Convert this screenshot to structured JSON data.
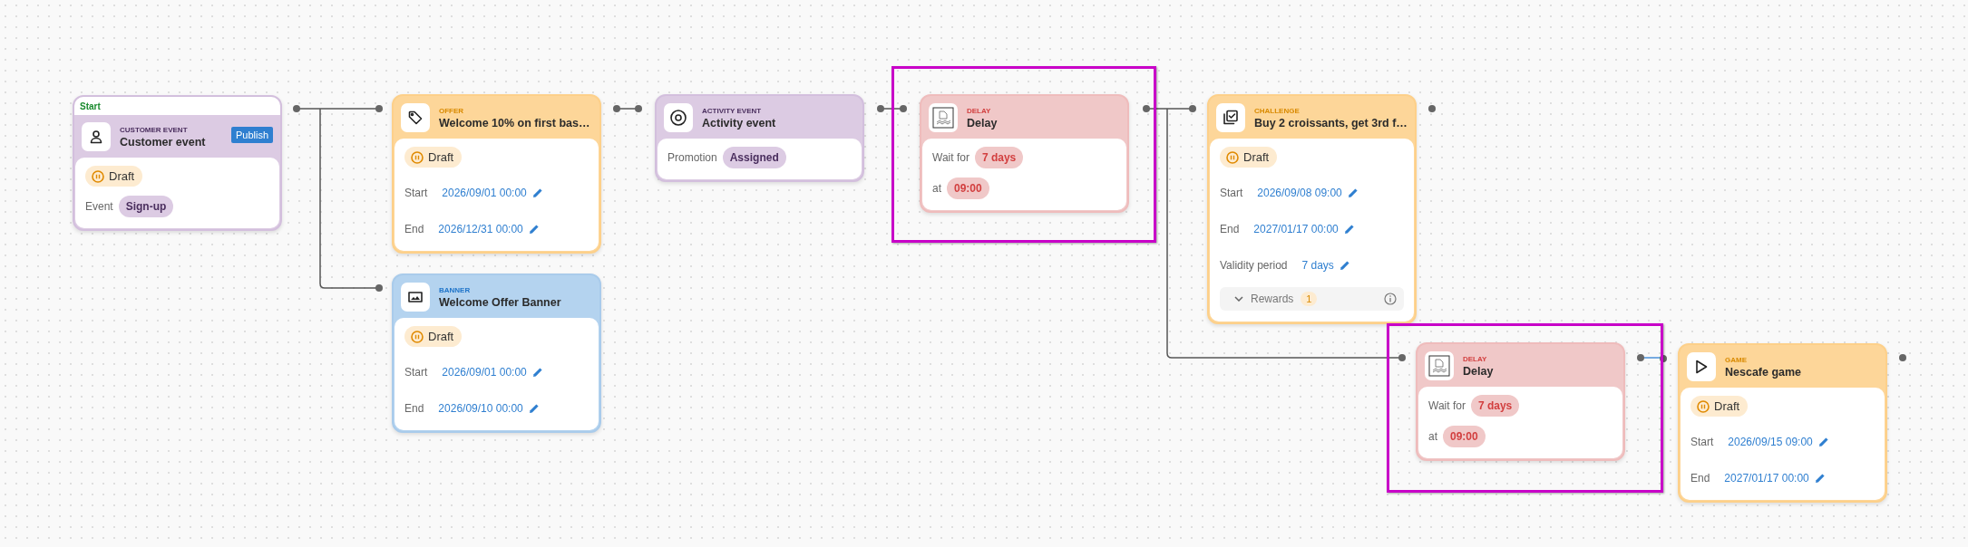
{
  "nodes": [
    {
      "kind": "customer_event",
      "start_label": "Start",
      "category": "CUSTOMER EVENT",
      "title": "Customer event",
      "action": "Publish",
      "status": "Draft",
      "highlighted": false,
      "fields": [
        {
          "kind": "chip",
          "label": "Event",
          "value": "Sign-up"
        }
      ]
    },
    {
      "kind": "offer",
      "category": "OFFER",
      "title": "Welcome 10% on first bas…",
      "status": "Draft",
      "highlighted": false,
      "fields": [
        {
          "kind": "editable",
          "label": "Start",
          "value": "2026/09/01 00:00"
        },
        {
          "kind": "editable",
          "label": "End",
          "value": "2026/12/31 00:00"
        }
      ]
    },
    {
      "kind": "banner",
      "category": "BANNER",
      "title": "Welcome Offer Banner",
      "status": "Draft",
      "highlighted": false,
      "fields": [
        {
          "kind": "editable",
          "label": "Start",
          "value": "2026/09/01 00:00"
        },
        {
          "kind": "editable",
          "label": "End",
          "value": "2026/09/10 00:00"
        }
      ]
    },
    {
      "kind": "activity_event",
      "category": "ACTIVITY EVENT",
      "title": "Activity event",
      "highlighted": false,
      "fields": [
        {
          "kind": "chip",
          "label": "Promotion",
          "value": "Assigned"
        }
      ]
    },
    {
      "kind": "delay",
      "category": "DELAY",
      "title": "Delay",
      "highlighted": true,
      "fields": [
        {
          "kind": "chip",
          "label": "Wait for",
          "value": "7 days"
        },
        {
          "kind": "chip",
          "label": "at",
          "value": "09:00"
        }
      ]
    },
    {
      "kind": "challenge",
      "category": "CHALLENGE",
      "title": "Buy 2 croissants, get 3rd f…",
      "status": "Draft",
      "highlighted": false,
      "fields": [
        {
          "kind": "editable",
          "label": "Start",
          "value": "2026/09/08 09:00"
        },
        {
          "kind": "editable",
          "label": "End",
          "value": "2027/01/17 00:00"
        },
        {
          "kind": "editable",
          "label": "Validity period",
          "value": "7 days"
        }
      ],
      "rewards": {
        "label": "Rewards",
        "count": "1",
        "expanded": false
      }
    },
    {
      "kind": "delay",
      "category": "DELAY",
      "title": "Delay",
      "highlighted": true,
      "fields": [
        {
          "kind": "chip",
          "label": "Wait for",
          "value": "7 days"
        },
        {
          "kind": "chip",
          "label": "at",
          "value": "09:00"
        }
      ]
    },
    {
      "kind": "game",
      "category": "GAME",
      "title": "Nescafe game",
      "status": "Draft",
      "highlighted": false,
      "fields": [
        {
          "kind": "editable",
          "label": "Start",
          "value": "2026/09/15 09:00"
        },
        {
          "kind": "editable",
          "label": "End",
          "value": "2027/01/17 00:00"
        }
      ]
    }
  ]
}
